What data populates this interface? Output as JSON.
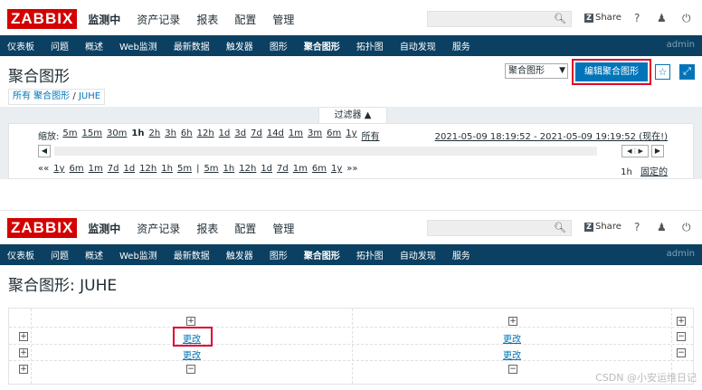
{
  "logo": "ZABBIX",
  "main_menu": [
    "监测中",
    "资产记录",
    "报表",
    "配置",
    "管理"
  ],
  "share_label": "Share",
  "help_label": "?",
  "sub_menu": [
    "仪表板",
    "问题",
    "概述",
    "Web监测",
    "最新数据",
    "触发器",
    "图形",
    "聚合图形",
    "拓扑图",
    "自动发现",
    "服务"
  ],
  "user": "admin",
  "top": {
    "title": "聚合图形",
    "select_value": "聚合图形",
    "edit_button": "编辑聚合图形",
    "breadcrumb_all": "所有 聚合图形",
    "breadcrumb_sep": "/",
    "breadcrumb_current": "JUHE",
    "filter_tab": "过滤器 ▲",
    "zoom_label": "缩放:",
    "zoom_options": [
      "5m",
      "15m",
      "30m",
      "1h",
      "2h",
      "3h",
      "6h",
      "12h",
      "1d",
      "3d",
      "7d",
      "14d",
      "1m",
      "3m",
      "6m",
      "1y",
      "所有"
    ],
    "range": "2021-05-09 18:19:52 - 2021-05-09 19:19:52 (现在!)",
    "nav_back": [
      "««",
      "1y",
      "6m",
      "1m",
      "7d",
      "1d",
      "12h",
      "1h",
      "5m"
    ],
    "nav_sep": "|",
    "nav_fwd": [
      "5m",
      "1h",
      "12h",
      "1d",
      "7d",
      "1m",
      "6m",
      "1y",
      "»»"
    ],
    "period": "1h",
    "fixed": "固定的"
  },
  "bottom": {
    "title": "聚合图形: JUHE",
    "change_label": "更改"
  },
  "watermark": "CSDN @小安运维日记",
  "colors": {
    "brand": "#d40000",
    "nav": "#0b4062",
    "accent": "#0275b8",
    "highlight": "#e0002b"
  }
}
